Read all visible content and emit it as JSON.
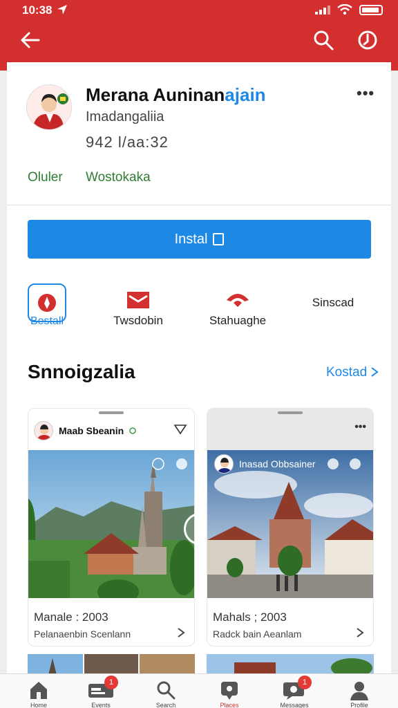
{
  "status_bar": {
    "time": "10:38"
  },
  "app": {
    "title_main": "Merana Auninan",
    "title_accent": "ajain",
    "subtitle": "Imadangaliia",
    "code": "942 l/aa:32",
    "tags": [
      "Oluler",
      "Wostokaka"
    ],
    "more": "•••",
    "install_label": "Instal",
    "colors": {
      "brand": "#d32f2f",
      "accent": "#1e88e5",
      "tag": "#2e7d32"
    }
  },
  "actions": [
    {
      "label": "Bestall",
      "icon": "pin-icon"
    },
    {
      "label": "Twsdobin",
      "icon": "mail-icon"
    },
    {
      "label": "Stahuaghe",
      "icon": "cloud-icon"
    },
    {
      "label": "Sinscad",
      "icon": ""
    }
  ],
  "section": {
    "title": "Snnoigzalia",
    "link": "Kostad"
  },
  "posts": [
    {
      "author": "Maab Sbeanin",
      "caption": "Manale : 2003",
      "sub": "Pelanaenbin Scenlann"
    },
    {
      "author": "Inasad Obbsainer",
      "caption": "Mahals ; 2003",
      "sub": "Radck bain Aeanlam",
      "more": "•••"
    }
  ],
  "nav": [
    {
      "label": "Home",
      "icon": "home-icon"
    },
    {
      "label": "Events",
      "icon": "card-icon",
      "badge": "1"
    },
    {
      "label": "Search",
      "icon": "search-icon"
    },
    {
      "label": "Places",
      "icon": "pin-icon"
    },
    {
      "label": "Messages",
      "icon": "chat-icon",
      "badge": "1"
    },
    {
      "label": "Profile",
      "icon": "user-icon"
    }
  ]
}
